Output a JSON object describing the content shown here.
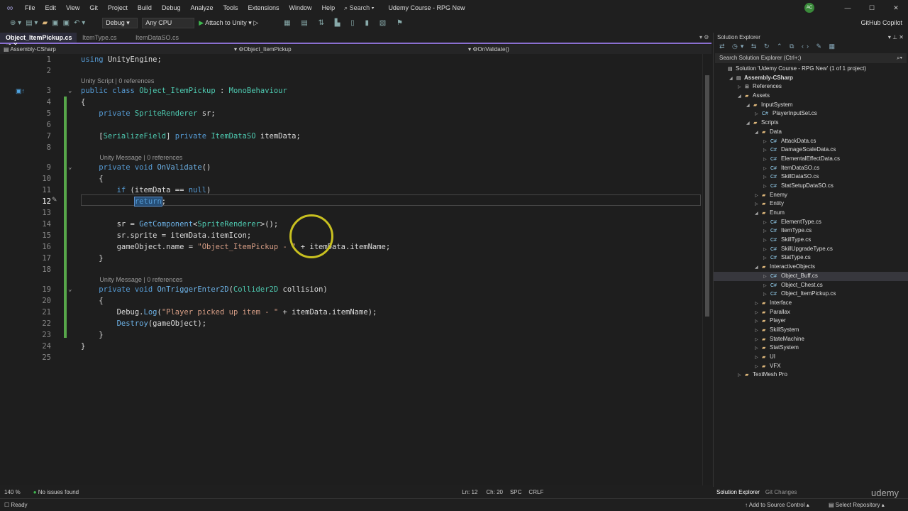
{
  "menu": {
    "items": [
      "File",
      "Edit",
      "View",
      "Git",
      "Project",
      "Build",
      "Debug",
      "Analyze",
      "Tools",
      "Extensions",
      "Window",
      "Help"
    ],
    "search": "Search",
    "title": "Udemy Course - RPG New",
    "avatar": "AC",
    "copilot": "GitHub Copilot"
  },
  "toolbar": {
    "config": "Debug",
    "platform": "Any CPU",
    "run": "Attach to Unity"
  },
  "tabs": [
    {
      "label": "Object_ItemPickup.cs",
      "active": true
    },
    {
      "label": "ItemType.cs"
    },
    {
      "label": "ItemDataSO.cs"
    }
  ],
  "navbar": {
    "project": "Assembly-CSharp",
    "class": "Object_ItemPickup",
    "member": "OnValidate()"
  },
  "code": [
    {
      "n": "1",
      "tokens": [
        [
          "using ",
          "k"
        ],
        [
          "UnityEngine;",
          "p"
        ]
      ]
    },
    {
      "n": "2",
      "tokens": []
    },
    {
      "lens": "Unity Script | 0 references",
      "indent": 0
    },
    {
      "n": "3",
      "fold": true,
      "tokens": [
        [
          "public class ",
          "k"
        ],
        [
          "Object_ItemPickup",
          "t"
        ],
        [
          " : ",
          "p"
        ],
        [
          "MonoBehaviour",
          "t"
        ]
      ]
    },
    {
      "n": "4",
      "tokens": [
        [
          "{",
          "p"
        ]
      ]
    },
    {
      "n": "5",
      "tokens": [
        [
          "    private ",
          "k"
        ],
        [
          "SpriteRenderer",
          "t"
        ],
        [
          " sr;",
          "p"
        ]
      ]
    },
    {
      "n": "6",
      "tokens": []
    },
    {
      "n": "7",
      "tokens": [
        [
          "    [",
          "p"
        ],
        [
          "SerializeField",
          "t"
        ],
        [
          "] ",
          "p"
        ],
        [
          "private ",
          "k"
        ],
        [
          "ItemDataSO",
          "t"
        ],
        [
          " itemData;",
          "p"
        ]
      ]
    },
    {
      "n": "8",
      "tokens": []
    },
    {
      "lens": "Unity Message | 0 references",
      "indent": 4
    },
    {
      "n": "9",
      "fold": true,
      "tokens": [
        [
          "    private void ",
          "k"
        ],
        [
          "OnValidate",
          "m"
        ],
        [
          "()",
          "p"
        ]
      ]
    },
    {
      "n": "10",
      "tokens": [
        [
          "    {",
          "p"
        ]
      ]
    },
    {
      "n": "11",
      "tokens": [
        [
          "        if ",
          "k"
        ],
        [
          "(itemData == ",
          "p"
        ],
        [
          "null",
          "k"
        ],
        [
          ")",
          "p"
        ]
      ]
    },
    {
      "n": "12",
      "current": true,
      "tokens": [
        [
          "            ",
          "p"
        ],
        [
          "return",
          "k sel"
        ],
        [
          ";",
          "p"
        ]
      ]
    },
    {
      "n": "13",
      "tokens": []
    },
    {
      "n": "14",
      "tokens": [
        [
          "        sr = ",
          "p"
        ],
        [
          "GetComponent",
          "m"
        ],
        [
          "<",
          "p"
        ],
        [
          "SpriteRenderer",
          "t"
        ],
        [
          ">();",
          "p"
        ]
      ]
    },
    {
      "n": "15",
      "tokens": [
        [
          "        sr.sprite = itemData.itemIcon;",
          "p"
        ]
      ]
    },
    {
      "n": "16",
      "tokens": [
        [
          "        gameObject.name = ",
          "p"
        ],
        [
          "\"Object_ItemPickup - \"",
          "s"
        ],
        [
          " + itemData.itemName;",
          "p"
        ]
      ]
    },
    {
      "n": "17",
      "tokens": [
        [
          "    }",
          "p"
        ]
      ]
    },
    {
      "n": "18",
      "tokens": []
    },
    {
      "lens": "Unity Message | 0 references",
      "indent": 4
    },
    {
      "n": "19",
      "fold": true,
      "tokens": [
        [
          "    private void ",
          "k"
        ],
        [
          "OnTriggerEnter2D",
          "m"
        ],
        [
          "(",
          "p"
        ],
        [
          "Collider2D",
          "t"
        ],
        [
          " collision)",
          "p"
        ]
      ]
    },
    {
      "n": "20",
      "tokens": [
        [
          "    {",
          "p"
        ]
      ]
    },
    {
      "n": "21",
      "tokens": [
        [
          "        Debug.",
          "p"
        ],
        [
          "Log",
          "m"
        ],
        [
          "(",
          "p"
        ],
        [
          "\"Player picked up item - \"",
          "s"
        ],
        [
          " + itemData.itemName);",
          "p"
        ]
      ]
    },
    {
      "n": "22",
      "tokens": [
        [
          "        ",
          "p"
        ],
        [
          "Destroy",
          "m"
        ],
        [
          "(gameObject);",
          "p"
        ]
      ]
    },
    {
      "n": "23",
      "tokens": [
        [
          "    }",
          "p"
        ]
      ]
    },
    {
      "n": "24",
      "tokens": [
        [
          "}",
          "p"
        ]
      ]
    },
    {
      "n": "25",
      "tokens": []
    }
  ],
  "editor_status": {
    "zoom": "140 %",
    "issues": "No issues found",
    "line": "Ln: 12",
    "col": "Ch: 20",
    "spc": "SPC",
    "eol": "CRLF"
  },
  "solution_explorer": {
    "title": "Solution Explorer",
    "search_placeholder": "Search Solution Explorer (Ctrl+;)",
    "nodes": [
      {
        "label": "Solution 'Udemy Course - RPG New' (1 of 1 project)",
        "depth": 0,
        "type": "solution",
        "exp": ""
      },
      {
        "label": "Assembly-CSharp",
        "depth": 1,
        "type": "project",
        "exp": "open",
        "bold": true
      },
      {
        "label": "References",
        "depth": 2,
        "type": "ref",
        "exp": "closed"
      },
      {
        "label": "Assets",
        "depth": 2,
        "type": "folder",
        "exp": "open"
      },
      {
        "label": "InputSystem",
        "depth": 3,
        "type": "folder",
        "exp": "open"
      },
      {
        "label": "PlayerInputSet.cs",
        "depth": 4,
        "type": "cs",
        "exp": "closed"
      },
      {
        "label": "Scripts",
        "depth": 3,
        "type": "folder",
        "exp": "open"
      },
      {
        "label": "Data",
        "depth": 4,
        "type": "folder",
        "exp": "open"
      },
      {
        "label": "AttackData.cs",
        "depth": 5,
        "type": "cs",
        "exp": "closed"
      },
      {
        "label": "DamageScaleData.cs",
        "depth": 5,
        "type": "cs",
        "exp": "closed"
      },
      {
        "label": "ElementalEffectData.cs",
        "depth": 5,
        "type": "cs",
        "exp": "closed"
      },
      {
        "label": "ItemDataSO.cs",
        "depth": 5,
        "type": "cs",
        "exp": "closed"
      },
      {
        "label": "SkillDataSO.cs",
        "depth": 5,
        "type": "cs",
        "exp": "closed"
      },
      {
        "label": "StatSetupDataSO.cs",
        "depth": 5,
        "type": "cs",
        "exp": "closed"
      },
      {
        "label": "Enemy",
        "depth": 4,
        "type": "folder",
        "exp": "closed"
      },
      {
        "label": "Entity",
        "depth": 4,
        "type": "folder",
        "exp": "closed"
      },
      {
        "label": "Enum",
        "depth": 4,
        "type": "folder",
        "exp": "open"
      },
      {
        "label": "ElementType.cs",
        "depth": 5,
        "type": "cs",
        "exp": "closed"
      },
      {
        "label": "ItemType.cs",
        "depth": 5,
        "type": "cs",
        "exp": "closed"
      },
      {
        "label": "SkillType.cs",
        "depth": 5,
        "type": "cs",
        "exp": "closed"
      },
      {
        "label": "SkillUpgradeType.cs",
        "depth": 5,
        "type": "cs",
        "exp": "closed"
      },
      {
        "label": "StatType.cs",
        "depth": 5,
        "type": "cs",
        "exp": "closed"
      },
      {
        "label": "InteractiveObjects",
        "depth": 4,
        "type": "folder",
        "exp": "open"
      },
      {
        "label": "Object_Buff.cs",
        "depth": 5,
        "type": "cs",
        "exp": "closed",
        "selected": true
      },
      {
        "label": "Object_Chest.cs",
        "depth": 5,
        "type": "cs",
        "exp": "closed"
      },
      {
        "label": "Object_ItemPickup.cs",
        "depth": 5,
        "type": "cs",
        "exp": "closed"
      },
      {
        "label": "Interface",
        "depth": 4,
        "type": "folder",
        "exp": "closed"
      },
      {
        "label": "Parallax",
        "depth": 4,
        "type": "folder",
        "exp": "closed"
      },
      {
        "label": "Player",
        "depth": 4,
        "type": "folder",
        "exp": "closed"
      },
      {
        "label": "SkillSystem",
        "depth": 4,
        "type": "folder",
        "exp": "closed"
      },
      {
        "label": "StateMachine",
        "depth": 4,
        "type": "folder",
        "exp": "closed"
      },
      {
        "label": "StatSystem",
        "depth": 4,
        "type": "folder",
        "exp": "closed"
      },
      {
        "label": "UI",
        "depth": 4,
        "type": "folder",
        "exp": "closed"
      },
      {
        "label": "VFX",
        "depth": 4,
        "type": "folder",
        "exp": "closed"
      },
      {
        "label": "TextMesh Pro",
        "depth": 2,
        "type": "folder",
        "exp": "closed"
      }
    ],
    "bottom_tabs": [
      "Solution Explorer",
      "Git Changes"
    ]
  },
  "statusbar": {
    "ready": "Ready",
    "source_control": "Add to Source Control",
    "repo": "Select Repository",
    "watermark": "udemy"
  }
}
